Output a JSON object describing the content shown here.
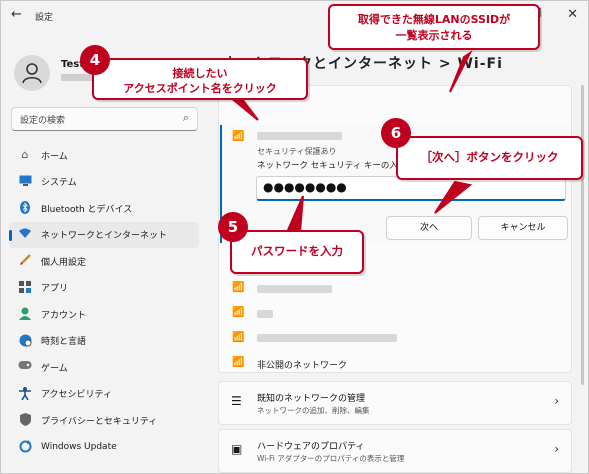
{
  "window": {
    "title": "設定"
  },
  "profile": {
    "name": "Test U"
  },
  "search": {
    "placeholder": "設定の検索"
  },
  "nav": [
    {
      "label": "ホーム",
      "icon": "home-icon"
    },
    {
      "label": "システム",
      "icon": "monitor-icon"
    },
    {
      "label": "Bluetooth とデバイス",
      "icon": "bluetooth-icon"
    },
    {
      "label": "ネットワークとインターネット",
      "icon": "wifi-icon",
      "active": true
    },
    {
      "label": "個人用設定",
      "icon": "brush-icon"
    },
    {
      "label": "アプリ",
      "icon": "apps-icon"
    },
    {
      "label": "アカウント",
      "icon": "person-icon"
    },
    {
      "label": "時刻と言語",
      "icon": "globe-icon"
    },
    {
      "label": "ゲーム",
      "icon": "gamepad-icon"
    },
    {
      "label": "アクセシビリティ",
      "icon": "accessibility-icon"
    },
    {
      "label": "プライバシーとセキュリティ",
      "icon": "shield-icon"
    },
    {
      "label": "Windows Update",
      "icon": "update-icon"
    }
  ],
  "content": {
    "title": "ネットワークとインターネット > Wi-Fi",
    "selected_network": {
      "security": "セキュリティ保護あり",
      "key_label": "ネットワーク セキュリティ キーの入力",
      "password_value": "●●●●●●●●",
      "next_button": "次へ",
      "cancel_button": "キャンセル"
    },
    "hidden_network": "非公開のネットワーク",
    "cards": [
      {
        "title": "既知のネットワークの管理",
        "subtitle": "ネットワークの追加、削除、編集",
        "icon": "list-icon"
      },
      {
        "title": "ハードウェアのプロパティ",
        "subtitle": "Wi-Fi アダプターのプロパティの表示と管理",
        "icon": "chip-icon"
      }
    ]
  },
  "callouts": {
    "c4_line1": "接続したい",
    "c4_line2": "アクセスポイント名をクリック",
    "c5": "パスワードを入力",
    "c6": "［次へ］ボタンをクリック",
    "top_line1": "取得できた無線LANのSSIDが",
    "top_line2": "一覧表示される",
    "n4": "4",
    "n5": "5",
    "n6": "6"
  },
  "colors": {
    "accent": "#0067c0",
    "callout": "#c0001f"
  }
}
